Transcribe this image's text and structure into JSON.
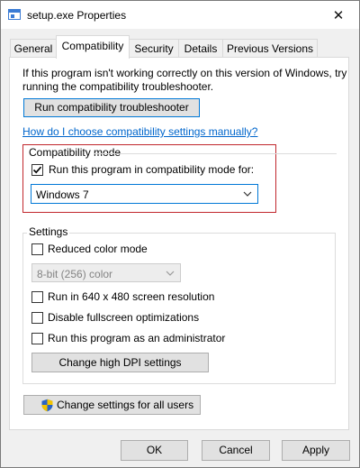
{
  "window": {
    "title": "setup.exe Properties",
    "close_glyph": "✕"
  },
  "tabs": [
    {
      "label": "General",
      "active": false
    },
    {
      "label": "Compatibility",
      "active": true
    },
    {
      "label": "Security",
      "active": false
    },
    {
      "label": "Details",
      "active": false
    },
    {
      "label": "Previous Versions",
      "active": false
    }
  ],
  "compat": {
    "intro_line1": "If this program isn't working correctly on this version of Windows, try",
    "intro_line2": "running the compatibility troubleshooter.",
    "troubleshooter_button": "Run compatibility troubleshooter",
    "manual_link": "How do I choose compatibility settings manually?",
    "mode_group": {
      "title": "Compatibility mode",
      "checkbox_label": "Run this program in compatibility mode for:",
      "checked": true,
      "selected_os": "Windows 7",
      "highlight_color": "#c1272d"
    }
  },
  "settings": {
    "title": "Settings",
    "reduced_color_label": "Reduced color mode",
    "reduced_color_checked": false,
    "color_depth_selected": "8-bit (256) color",
    "color_depth_enabled": false,
    "resolution_label": "Run in 640 x 480 screen resolution",
    "resolution_checked": false,
    "fullscreen_label": "Disable fullscreen optimizations",
    "fullscreen_checked": false,
    "admin_label": "Run this program as an administrator",
    "admin_checked": false,
    "dpi_button": "Change high DPI settings"
  },
  "all_users_button": "Change settings for all users",
  "footer": {
    "ok": "OK",
    "cancel": "Cancel",
    "apply": "Apply"
  },
  "colors": {
    "accent": "#0078d7",
    "link": "#0066cc",
    "titlebar": "#ffffff",
    "face": "#f0f0f0"
  }
}
